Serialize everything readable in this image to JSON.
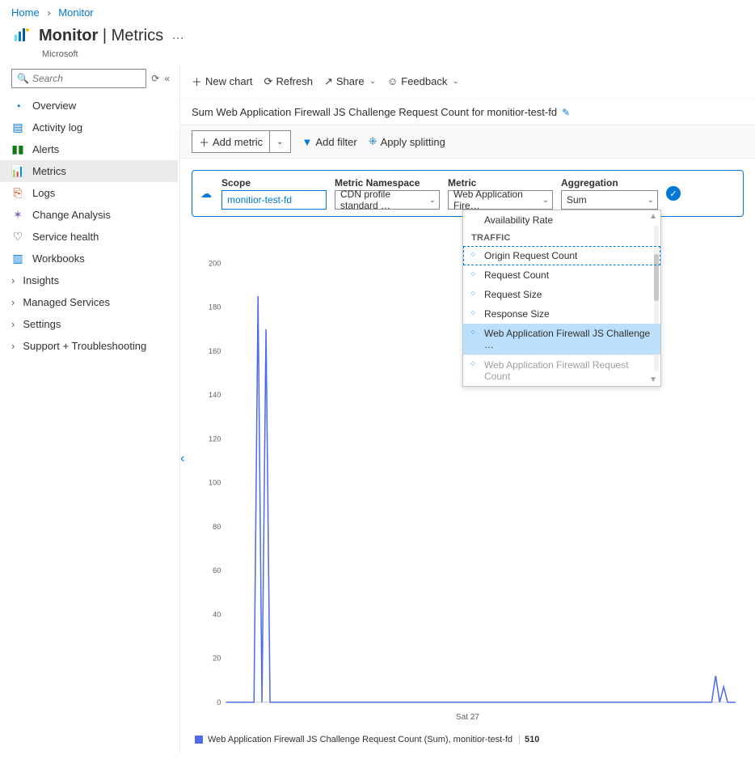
{
  "breadcrumb": {
    "home": "Home",
    "current": "Monitor"
  },
  "header": {
    "title_main": "Monitor",
    "title_sub": "Metrics",
    "org": "Microsoft",
    "more": "…"
  },
  "search": {
    "placeholder": "Search",
    "pin_glyph": "⟳",
    "collapse_glyph": "«"
  },
  "nav": {
    "overview": "Overview",
    "activity": "Activity log",
    "alerts": "Alerts",
    "metrics": "Metrics",
    "logs": "Logs",
    "change": "Change Analysis",
    "service": "Service health",
    "workbooks": "Workbooks",
    "insights": "Insights",
    "managed": "Managed Services",
    "settings": "Settings",
    "support": "Support + Troubleshooting"
  },
  "toolbar": {
    "newchart": "New chart",
    "refresh": "Refresh",
    "share": "Share",
    "feedback": "Feedback"
  },
  "chart_title": "Sum Web Application Firewall JS Challenge Request Count for monitior-test-fd",
  "metricbar": {
    "add": "Add metric",
    "filter": "Add filter",
    "split": "Apply splitting"
  },
  "config": {
    "scope_label": "Scope",
    "scope_value": "monitior-test-fd",
    "ns_label": "Metric Namespace",
    "ns_value": "CDN profile standard …",
    "metric_label": "Metric",
    "metric_value": "Web Application Fire…",
    "agg_label": "Aggregation",
    "agg_value": "Sum"
  },
  "dropdown": {
    "opt0": "Availability Rate",
    "group": "TRAFFIC",
    "opt1": "Origin Request Count",
    "opt2": "Request Count",
    "opt3": "Request Size",
    "opt4": "Response Size",
    "opt5": "Web Application Firewall JS Challenge …",
    "opt6": "Web Application Firewall Request Count"
  },
  "chart_data": {
    "type": "line",
    "ymax": 210,
    "ticks": [
      200,
      180,
      160,
      140,
      120,
      100,
      80,
      60,
      40,
      20,
      0
    ],
    "x_label": "Sat 27",
    "series": [
      {
        "name": "Web Application Firewall JS Challenge Request Count (Sum)",
        "color": "#4f6bed",
        "values": [
          0,
          0,
          0,
          0,
          0,
          0,
          0,
          0,
          185,
          0,
          170,
          0,
          0,
          0,
          0,
          0,
          0,
          0,
          0,
          0,
          0,
          0,
          0,
          0,
          0,
          0,
          0,
          0,
          0,
          0,
          0,
          0,
          0,
          0,
          0,
          0,
          0,
          0,
          0,
          0,
          0,
          0,
          0,
          0,
          0,
          0,
          0,
          0,
          0,
          0,
          0,
          0,
          0,
          0,
          0,
          0,
          0,
          0,
          0,
          0,
          0,
          0,
          0,
          0,
          0,
          0,
          0,
          0,
          0,
          0,
          0,
          0,
          0,
          0,
          0,
          0,
          0,
          0,
          0,
          0,
          0,
          0,
          0,
          0,
          0,
          0,
          0,
          0,
          0,
          0,
          0,
          0,
          0,
          0,
          0,
          0,
          0,
          0,
          0,
          0,
          0,
          0,
          0,
          0,
          0,
          0,
          0,
          0,
          0,
          0,
          0,
          0,
          0,
          0,
          0,
          0,
          0,
          0,
          0,
          0,
          0,
          0,
          12,
          0,
          7,
          0,
          0,
          0
        ]
      }
    ]
  },
  "legend": {
    "text": "Web Application Firewall JS Challenge Request Count (Sum), monitior-test-fd",
    "value": "510"
  }
}
